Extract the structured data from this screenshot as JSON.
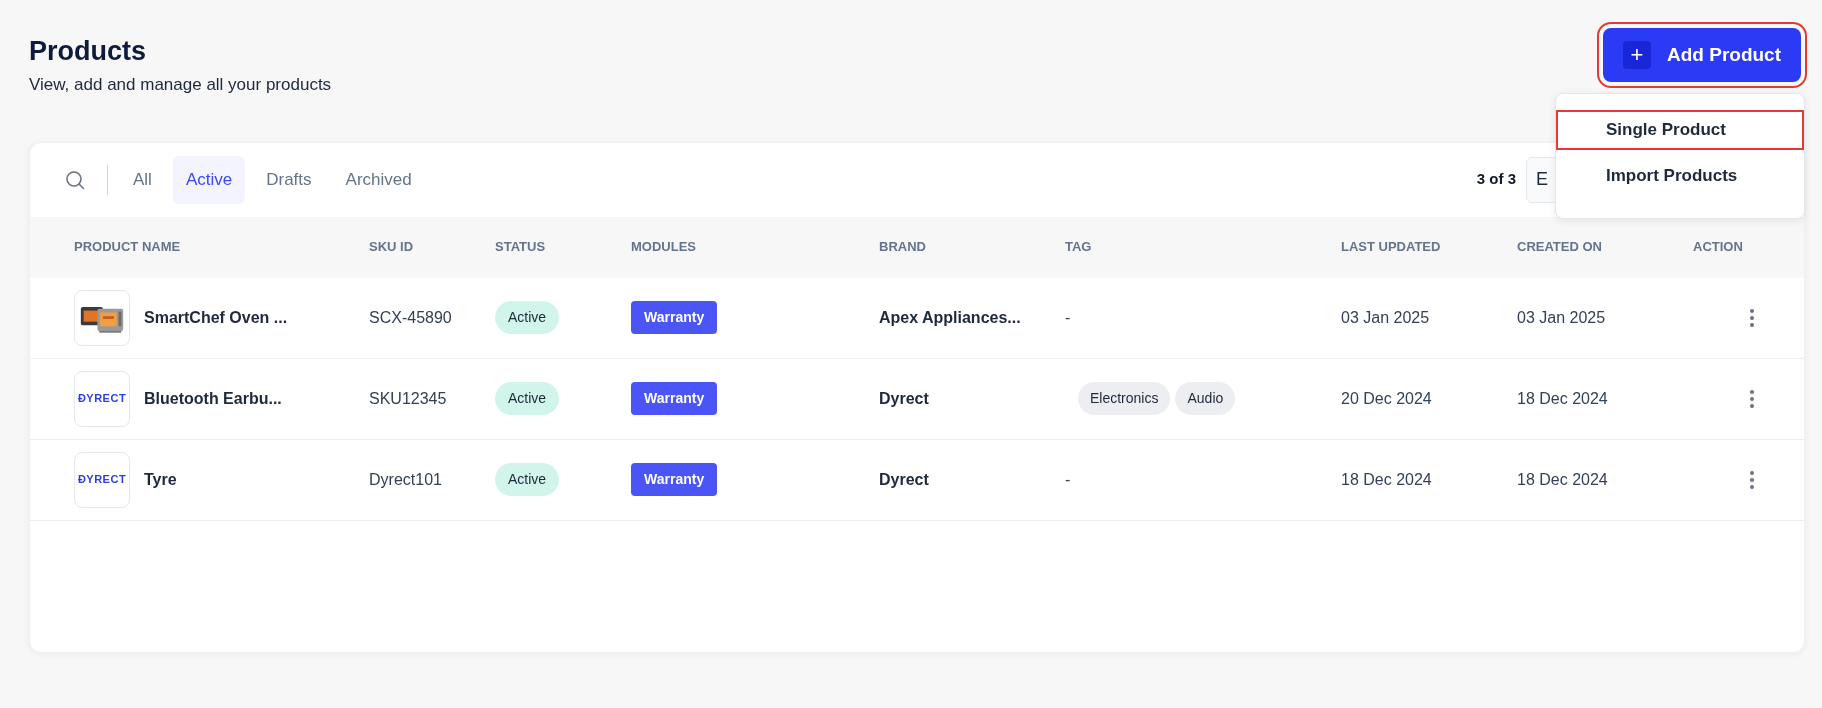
{
  "header": {
    "title": "Products",
    "subtitle": "View, add and manage all your products"
  },
  "add_button": {
    "label": "Add Product",
    "icon": "+",
    "highlighted": true
  },
  "menu": [
    {
      "label": "Single Product",
      "highlighted": true
    },
    {
      "label": "Import Products",
      "highlighted": false
    }
  ],
  "tabs": [
    {
      "label": "All",
      "selected": false
    },
    {
      "label": "Active",
      "selected": true
    },
    {
      "label": "Drafts",
      "selected": false
    },
    {
      "label": "Archived",
      "selected": false
    }
  ],
  "pager": {
    "count": "3 of 3",
    "button": "E"
  },
  "table": {
    "columns": [
      "PRODUCT NAME",
      "SKU ID",
      "STATUS",
      "MODULES",
      "BRAND",
      "TAG",
      "LAST UPDATED",
      "CREATED ON",
      "ACTION"
    ],
    "rows": [
      {
        "name": "SmartChef Oven ...",
        "sku": "SCX-45890",
        "status": "Active",
        "module": "Warranty",
        "brand": "Apex Appliances...",
        "tags": [],
        "tag_empty": "-",
        "updated": "03 Jan 2025",
        "created": "03 Jan 2025"
      },
      {
        "thumb": {
          "kind": "logo",
          "text": "ĐYRECT"
        },
        "name": "Bluetooth Earbu...",
        "sku": "SKU12345",
        "status": "Active",
        "module": "Warranty",
        "brand": "Dyrect",
        "tags": [
          "Electronics",
          "Audio"
        ],
        "updated": "20 Dec 2024",
        "created": "18 Dec 2024"
      },
      {
        "thumb": {
          "kind": "logo",
          "text": "ĐYRECT"
        },
        "name": "Tyre",
        "sku": "Dyrect101",
        "status": "Active",
        "module": "Warranty",
        "brand": "Dyrect",
        "tags": [],
        "tag_empty": "-",
        "updated": "18 Dec 2024",
        "created": "18 Dec 2024"
      }
    ]
  }
}
